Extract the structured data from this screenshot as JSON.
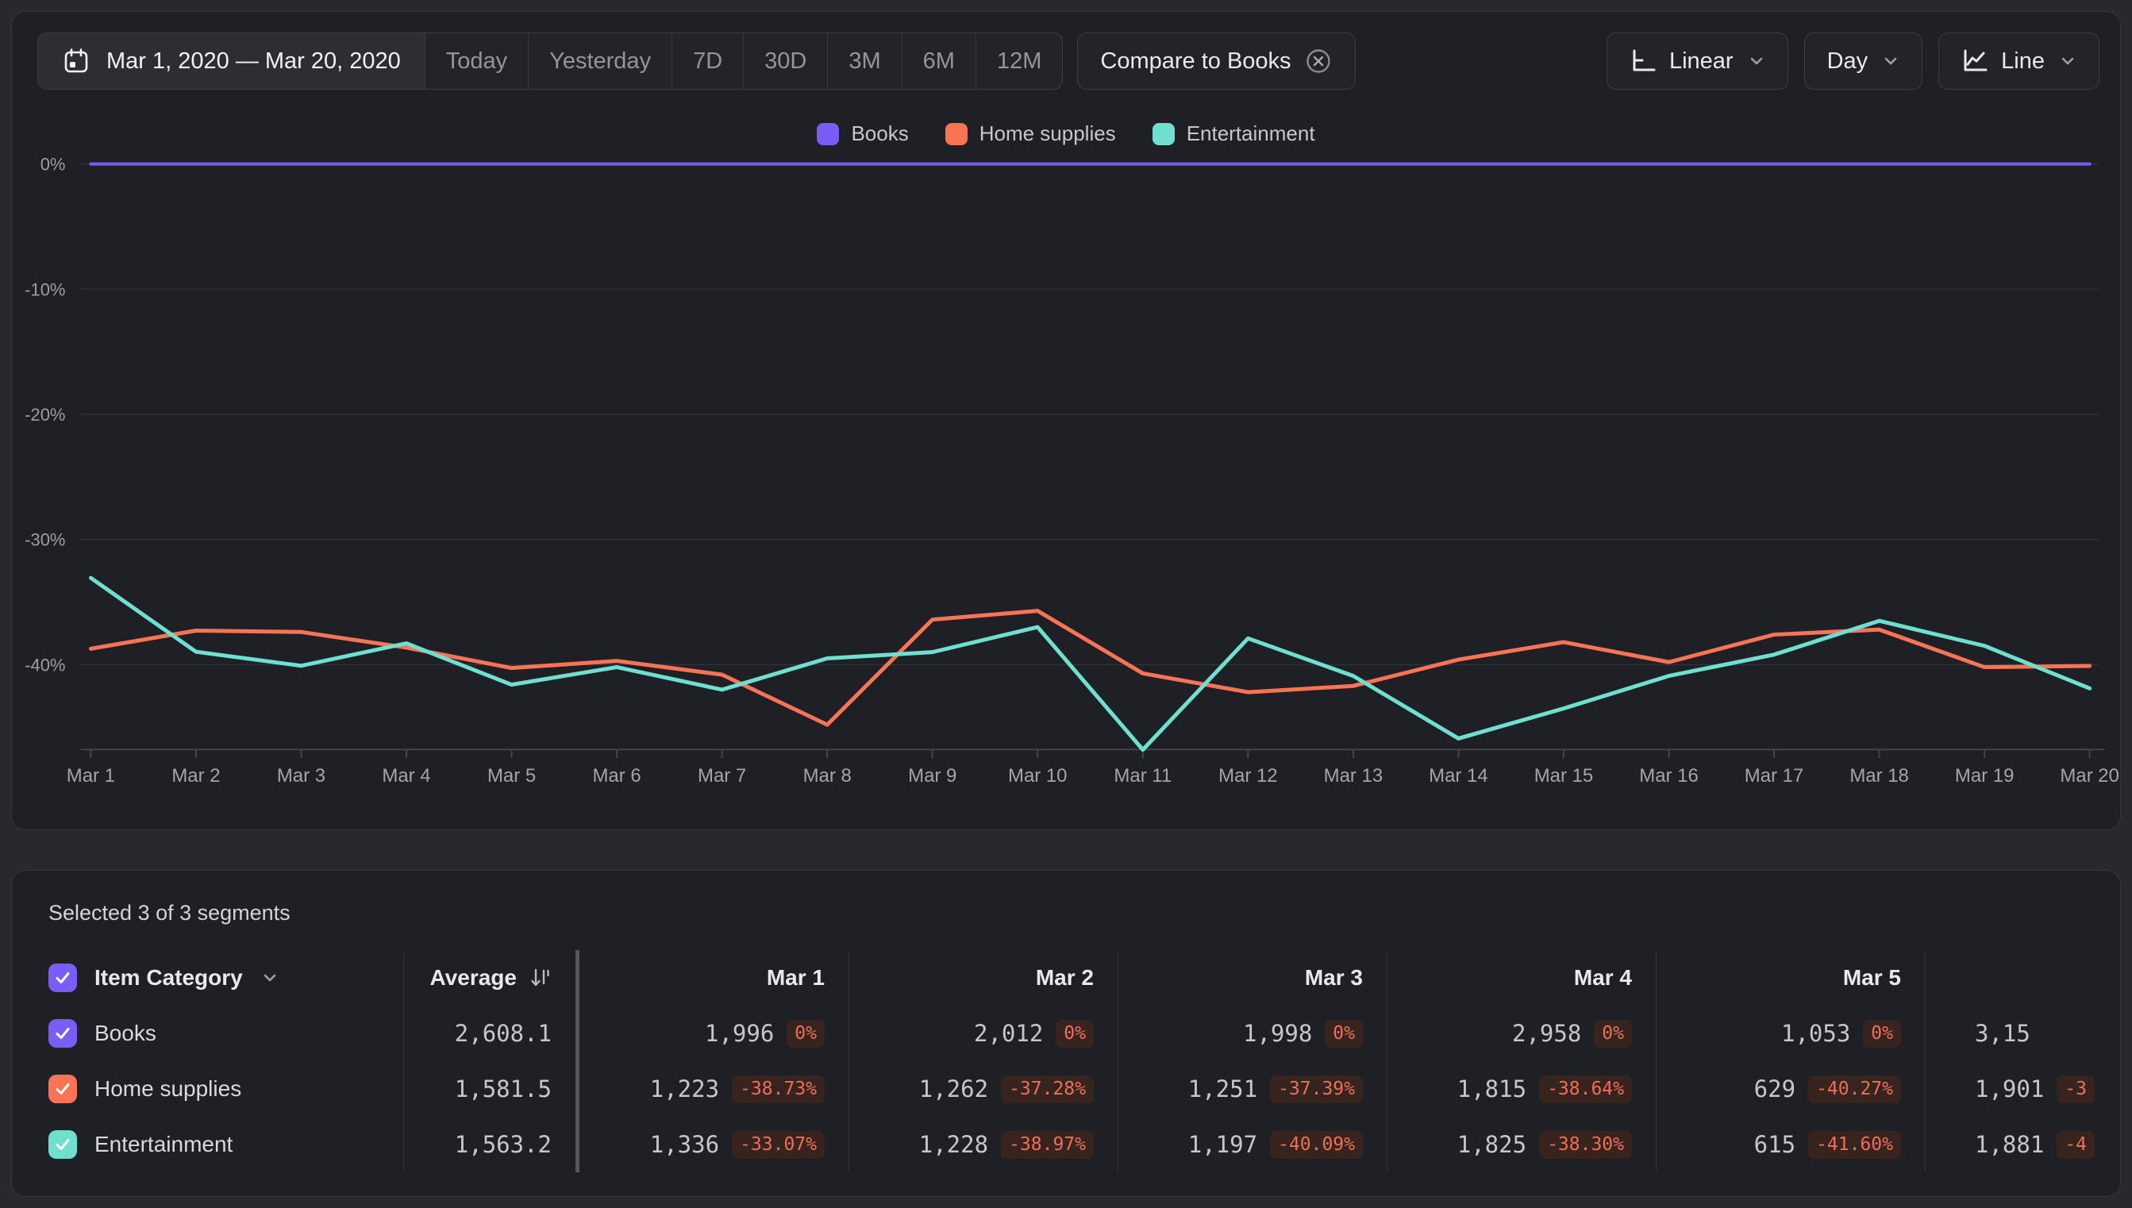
{
  "toolbar": {
    "date_range": "Mar 1, 2020 — Mar 20, 2020",
    "presets": [
      "Today",
      "Yesterday",
      "7D",
      "30D",
      "3M",
      "6M",
      "12M"
    ],
    "compare_label": "Compare to Books",
    "scale_label": "Linear",
    "granularity_label": "Day",
    "chart_type_label": "Line"
  },
  "legend": [
    {
      "label": "Books",
      "color": "#7a5cf6"
    },
    {
      "label": "Home supplies",
      "color": "#f87455"
    },
    {
      "label": "Entertainment",
      "color": "#6fdfcf"
    }
  ],
  "chart_data": {
    "type": "line",
    "x": [
      "Mar 1",
      "Mar 2",
      "Mar 3",
      "Mar 4",
      "Mar 5",
      "Mar 6",
      "Mar 7",
      "Mar 8",
      "Mar 9",
      "Mar 10",
      "Mar 11",
      "Mar 12",
      "Mar 13",
      "Mar 14",
      "Mar 15",
      "Mar 16",
      "Mar 17",
      "Mar 18",
      "Mar 19",
      "Mar 20"
    ],
    "y_unit": "%",
    "y_ticks": [
      {
        "label": "0%",
        "value": 0
      },
      {
        "label": "-10%",
        "value": -10
      },
      {
        "label": "-20%",
        "value": -20
      },
      {
        "label": "-30%",
        "value": -30
      },
      {
        "label": "-40%",
        "value": -40
      }
    ],
    "ylim": [
      -48,
      0
    ],
    "grid": true,
    "legend_position": "top-center",
    "series": [
      {
        "name": "Books",
        "color": "#7a5cf6",
        "values": [
          0,
          0,
          0,
          0,
          0,
          0,
          0,
          0,
          0,
          0,
          0,
          0,
          0,
          0,
          0,
          0,
          0,
          0,
          0,
          0
        ]
      },
      {
        "name": "Home supplies",
        "color": "#f87455",
        "values": [
          -38.73,
          -37.28,
          -37.39,
          -38.64,
          -40.27,
          -39.7,
          -40.8,
          -44.8,
          -36.4,
          -35.7,
          -40.7,
          -42.2,
          -41.7,
          -39.6,
          -38.2,
          -39.8,
          -37.6,
          -37.2,
          -40.2,
          -40.1
        ]
      },
      {
        "name": "Entertainment",
        "color": "#6fdfcf",
        "values": [
          -33.07,
          -38.97,
          -40.09,
          -38.3,
          -41.6,
          -40.2,
          -42.0,
          -39.5,
          -39.0,
          -37.0,
          -46.8,
          -37.9,
          -40.9,
          -45.9,
          -43.5,
          -40.9,
          -39.2,
          -36.5,
          -38.5,
          -41.9
        ]
      }
    ]
  },
  "table": {
    "selected_text": "Selected 3 of 3 segments",
    "category_header": "Item Category",
    "average_header": "Average",
    "day_headers": [
      "Mar 1",
      "Mar 2",
      "Mar 3",
      "Mar 4",
      "Mar 5"
    ],
    "rows": [
      {
        "label": "Books",
        "color": "#7a5cf6",
        "average": "2,608.1",
        "cells": [
          [
            "1,996",
            "0%"
          ],
          [
            "2,012",
            "0%"
          ],
          [
            "1,998",
            "0%"
          ],
          [
            "2,958",
            "0%"
          ],
          [
            "1,053",
            "0%"
          ]
        ],
        "partial": [
          "3,15",
          ""
        ]
      },
      {
        "label": "Home supplies",
        "color": "#f87455",
        "average": "1,581.5",
        "cells": [
          [
            "1,223",
            "-38.73%"
          ],
          [
            "1,262",
            "-37.28%"
          ],
          [
            "1,251",
            "-37.39%"
          ],
          [
            "1,815",
            "-38.64%"
          ],
          [
            "629",
            "-40.27%"
          ]
        ],
        "partial": [
          "1,901",
          "-3"
        ]
      },
      {
        "label": "Entertainment",
        "color": "#6fdfcf",
        "average": "1,563.2",
        "cells": [
          [
            "1,336",
            "-33.07%"
          ],
          [
            "1,228",
            "-38.97%"
          ],
          [
            "1,197",
            "-40.09%"
          ],
          [
            "1,825",
            "-38.30%"
          ],
          [
            "615",
            "-41.60%"
          ]
        ],
        "partial": [
          "1,881",
          "-4"
        ]
      }
    ]
  }
}
